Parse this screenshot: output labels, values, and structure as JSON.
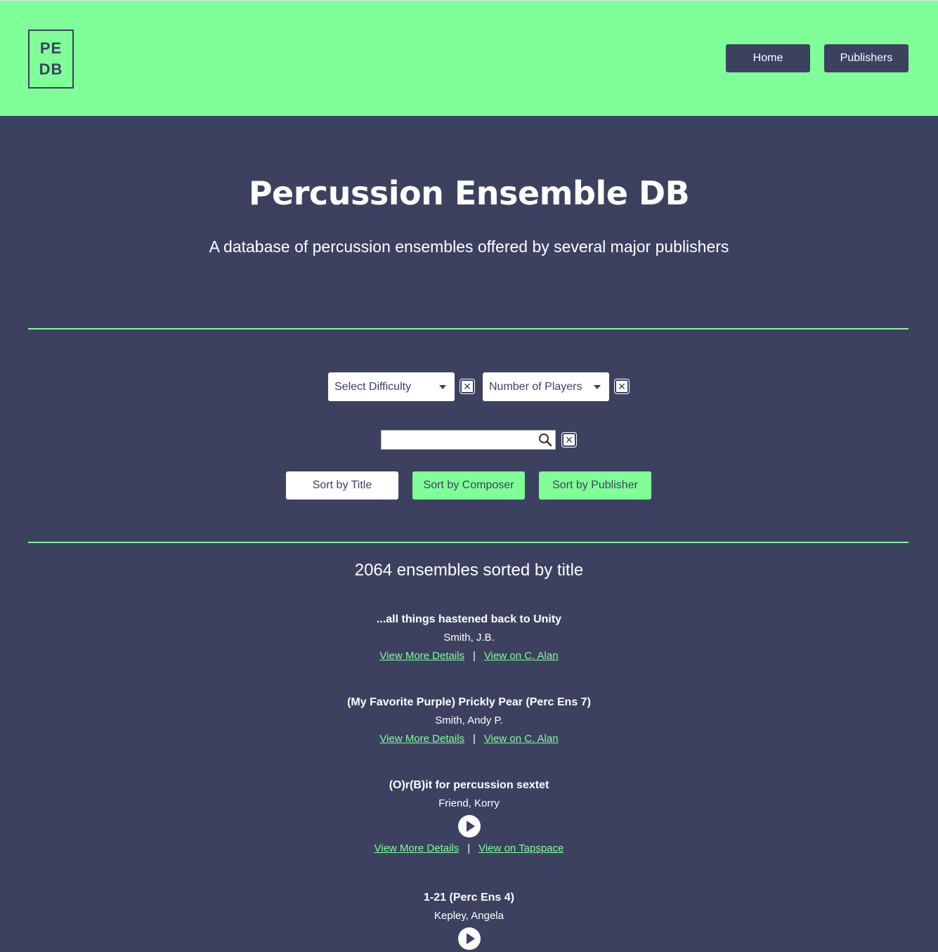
{
  "header": {
    "logo_line1": "PE",
    "logo_line2": "DB",
    "nav": [
      {
        "label": "Home"
      },
      {
        "label": "Publishers"
      }
    ]
  },
  "hero": {
    "title": "Percussion Ensemble DB",
    "subtitle": "A database of percussion ensembles offered by several major publishers"
  },
  "filters": {
    "difficulty_placeholder": "Select Difficulty",
    "players_placeholder": "Number of Players",
    "clear_icon": "close-icon",
    "search_value": "",
    "search_icon": "search-icon"
  },
  "sort": {
    "title_label": "Sort by Title",
    "composer_label": "Sort by Composer",
    "publisher_label": "Sort by Publisher"
  },
  "results": {
    "summary": "2064 ensembles sorted by title",
    "items": [
      {
        "title": "...all things hastened back to Unity",
        "composer": "Smith, J.B.",
        "details_label": "View More Details",
        "sep": "|",
        "publisher_link": "View on C. Alan"
      },
      {
        "title": "(My Favorite Purple) Prickly Pear (Perc Ens 7)",
        "composer": "Smith, Andy P.",
        "details_label": "View More Details",
        "sep": "|",
        "publisher_link": "View on C. Alan"
      },
      {
        "title": "(O)r(B)it for percussion sextet",
        "composer": "Friend, Korry",
        "details_label": "View More Details",
        "sep": "|",
        "publisher_link": "View on Tapspace"
      },
      {
        "title": "1-21 (Perc Ens 4)",
        "composer": "Kepley, Angela",
        "details_label": "",
        "sep": "",
        "publisher_link": ""
      }
    ]
  },
  "colors": {
    "accent": "#80fe98",
    "background": "#3d4160",
    "text": "#ffffff"
  }
}
